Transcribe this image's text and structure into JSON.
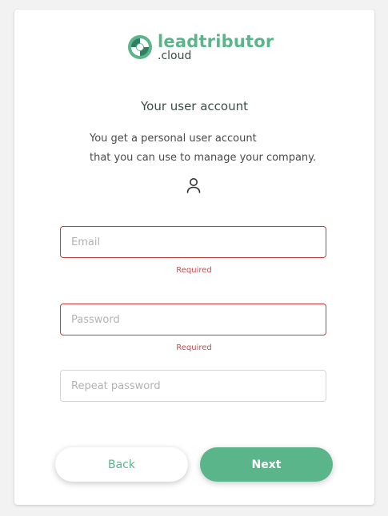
{
  "brand": {
    "name": "leadtributor",
    "tld": ".cloud",
    "color": "#5bb58b"
  },
  "heading": "Your user account",
  "intro": {
    "line1": "You get a personal user account",
    "line2": "that you can use to manage your company."
  },
  "icons": {
    "logo": "leadtributor-logo-icon",
    "user": "user-icon"
  },
  "form": {
    "email": {
      "placeholder": "Email",
      "value": "",
      "error": "Required"
    },
    "password": {
      "placeholder": "Password",
      "value": "",
      "error": "Required"
    },
    "repeat_password": {
      "placeholder": "Repeat password",
      "value": ""
    }
  },
  "buttons": {
    "back": "Back",
    "next": "Next"
  },
  "colors": {
    "accent": "#5bb58b",
    "error": "#d04848"
  }
}
